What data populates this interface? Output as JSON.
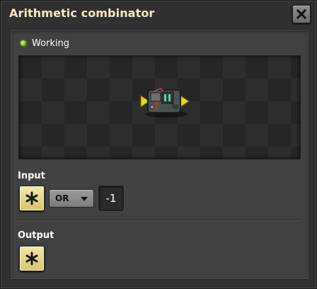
{
  "window": {
    "title": "Arithmetic combinator",
    "close_icon": "close-icon"
  },
  "status": {
    "text": "Working",
    "color": "#6fbf1c"
  },
  "preview": {
    "entity": "arithmetic-combinator",
    "background": "checkerboard"
  },
  "input": {
    "label": "Input",
    "first_signal_icon": "asterisk-icon",
    "operation": "OR",
    "constant": "-1"
  },
  "output": {
    "label": "Output",
    "signal_icon": "asterisk-icon"
  },
  "colors": {
    "title": "#ffe6c0",
    "signal_slot": "#e6d38a",
    "frame": "#313031",
    "panel": "#414141"
  }
}
